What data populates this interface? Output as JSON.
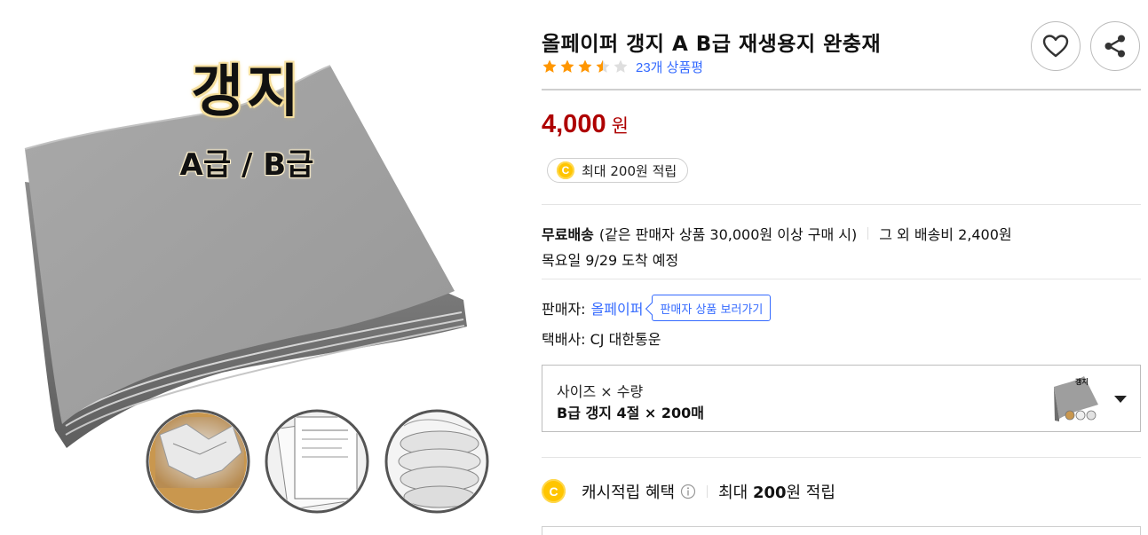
{
  "product_image": {
    "title_text": "갱지",
    "sub_text": "A급 / B급",
    "thumbnails": [
      "crumpled-paper-box",
      "paper-stack-documents",
      "rolled-paper-cushion"
    ]
  },
  "product": {
    "title": "올페이퍼 갱지 A B급 재생용지 완충재",
    "rating_stars": 3.5,
    "review_count_text": "23개 상품평"
  },
  "price": {
    "amount": "4,000",
    "currency": "원"
  },
  "reward": {
    "coin_symbol": "C",
    "text": "최대 200원 적립"
  },
  "shipping": {
    "free_label": "무료배송",
    "condition": "(같은 판매자 상품 30,000원 이상 구매 시)",
    "other_fee": "그 외 배송비 2,400원",
    "arrival": "목요일 9/29 도착 예정"
  },
  "seller": {
    "label": "판매자:",
    "name": "올페이퍼",
    "view_button": "판매자 상품 보러가기",
    "courier": "택배사: CJ 대한통운"
  },
  "option": {
    "label": "사이즈 × 수량",
    "value": "B급 갱지 4절 × 200매"
  },
  "cash_benefit": {
    "coin_symbol": "C",
    "label": "캐시적립 혜택",
    "prefix": "최대 ",
    "amount": "200",
    "suffix": "원 적립"
  },
  "colors": {
    "price": "#ae0000",
    "link": "#346aff",
    "star": "#ff9600",
    "coin": "#ffc500"
  }
}
